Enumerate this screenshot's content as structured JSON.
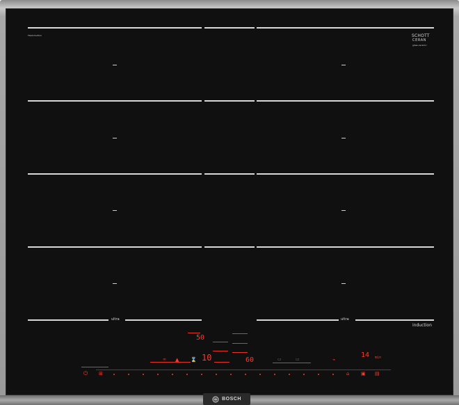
{
  "hob": {
    "top_left_label": "FlexInduction",
    "brand_top_right": "SCHOTT",
    "brand_top_right_sub": "CERAN",
    "brand_top_right_tiny": "glass-ceramic",
    "zone_badge_left": "ultra",
    "zone_badge_right": "ultra",
    "induction_label": "induction",
    "bottom_logo": "BOSCH"
  },
  "display": {
    "timer_top": "50",
    "level_main": "10",
    "level_secondary": "60",
    "right_timer": "14",
    "right_timer_unit": "min"
  },
  "icons": {
    "power": "power-icon",
    "child_lock": "lock-icon",
    "bosch_logo": "bosch-logo-icon"
  },
  "colors": {
    "accent": "#ff3a2a",
    "glass": "#101010",
    "lines": "#d9d9d9",
    "frame": "#a8a8a8"
  }
}
